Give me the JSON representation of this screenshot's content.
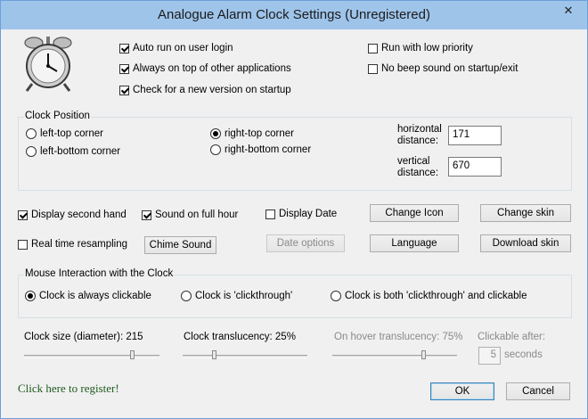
{
  "window": {
    "title": "Analogue Alarm Clock Settings (Unregistered)",
    "close_glyph": "✕"
  },
  "options": {
    "auto_run": {
      "label": "Auto run on user login",
      "checked": true
    },
    "always_on_top": {
      "label": "Always on top of other applications",
      "checked": true
    },
    "check_version": {
      "label": "Check for a new version on startup",
      "checked": true
    },
    "low_priority": {
      "label": "Run with low priority",
      "checked": false
    },
    "no_beep": {
      "label": "No beep sound on startup/exit",
      "checked": false
    }
  },
  "clock_position": {
    "title": "Clock Position",
    "left_top": {
      "label": "left-top corner",
      "selected": false
    },
    "left_bottom": {
      "label": "left-bottom corner",
      "selected": false
    },
    "right_top": {
      "label": "right-top corner",
      "selected": true
    },
    "right_bottom": {
      "label": "right-bottom corner",
      "selected": false
    },
    "horizontal_label_1": "horizontal",
    "horizontal_label_2": "distance:",
    "horizontal_value": "171",
    "vertical_label_1": "vertical",
    "vertical_label_2": "distance:",
    "vertical_value": "670"
  },
  "display": {
    "second_hand": {
      "label": "Display second hand",
      "checked": true
    },
    "sound_full_hour": {
      "label": "Sound on full hour",
      "checked": true
    },
    "display_date": {
      "label": "Display Date",
      "checked": false
    },
    "realtime_resampling": {
      "label": "Real time resampling",
      "checked": false
    },
    "chime_sound": "Chime Sound",
    "date_options": "Date options",
    "change_icon": "Change Icon",
    "change_skin": "Change skin",
    "language": "Language",
    "download_skin": "Download skin"
  },
  "mouse": {
    "title": "Mouse Interaction with the Clock",
    "always_clickable": {
      "label": "Clock is always clickable",
      "selected": true
    },
    "clickthrough": {
      "label": "Clock is 'clickthrough'",
      "selected": false
    },
    "both": {
      "label": "Clock is both 'clickthrough' and clickable",
      "selected": false
    }
  },
  "sliders": {
    "size": {
      "label": "Clock size (diameter): 215",
      "value": 215
    },
    "translucency": {
      "label": "Clock translucency: 25%",
      "value": 25
    },
    "hover_translucency": {
      "label": "On hover translucency: 75%",
      "value": 75
    },
    "clickable_after_label": "Clickable after:",
    "clickable_after_value": "5",
    "seconds_label": "seconds"
  },
  "footer": {
    "register_link": "Click here to register!",
    "ok": "OK",
    "cancel": "Cancel"
  }
}
